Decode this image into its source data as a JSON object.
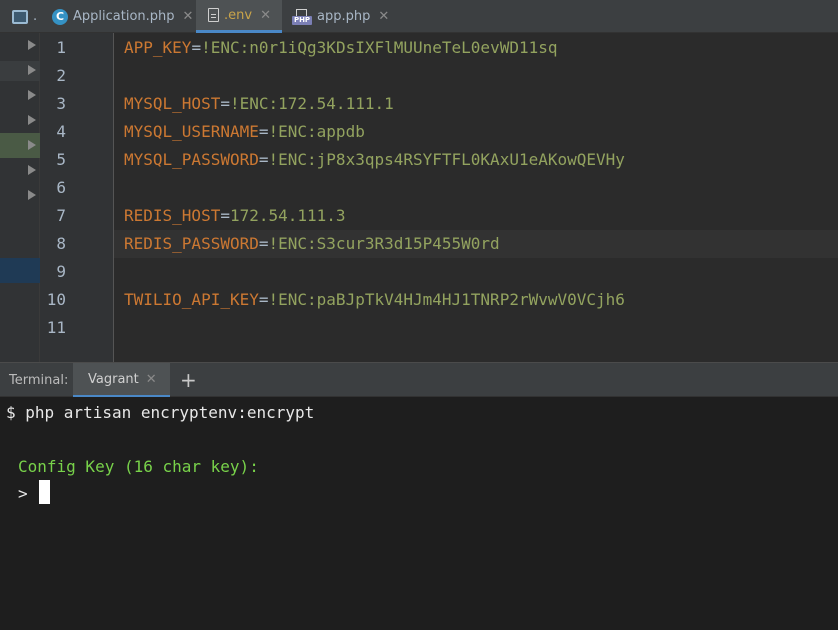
{
  "tabs": [
    {
      "label": ".",
      "icon": "project-icon"
    },
    {
      "label": "Application.php",
      "icon": "class-c-icon"
    },
    {
      "label": ".env",
      "icon": "text-file-icon",
      "active": true
    },
    {
      "label": "app.php",
      "icon": "php-file-icon"
    }
  ],
  "editor": {
    "line_numbers": [
      "1",
      "2",
      "3",
      "4",
      "5",
      "6",
      "7",
      "8",
      "9",
      "10",
      "11"
    ],
    "current_line": 8,
    "lines": [
      {
        "key": "APP_KEY",
        "eq": "=",
        "value": "!ENC:n0r1iQg3KDsIXFlMUUneTeL0evWD11sq"
      },
      {
        "key": "",
        "eq": "",
        "value": ""
      },
      {
        "key": "MYSQL_HOST",
        "eq": "=",
        "value": "!ENC:172.54.111.1"
      },
      {
        "key": "MYSQL_USERNAME",
        "eq": "=",
        "value": "!ENC:appdb"
      },
      {
        "key": "MYSQL_PASSWORD",
        "eq": "=",
        "value": "!ENC:jP8x3qps4RSYFTFL0KAxU1eAKowQEVHy"
      },
      {
        "key": "",
        "eq": "",
        "value": ""
      },
      {
        "key": "REDIS_HOST",
        "eq": "=",
        "value": "172.54.111.3"
      },
      {
        "key": "REDIS_PASSWORD",
        "eq": "=",
        "value": "!ENC:S3cur3R3d15P455W0rd"
      },
      {
        "key": "",
        "eq": "",
        "value": ""
      },
      {
        "key": "TWILIO_API_KEY",
        "eq": "=",
        "value": "!ENC:paBJpTkV4HJm4HJ1TNRP2rWvwV0VCjh6"
      },
      {
        "key": "",
        "eq": "",
        "value": ""
      }
    ]
  },
  "terminal": {
    "label": "Terminal:",
    "tab_label": "Vagrant",
    "close_glyph": "✕",
    "add_glyph": "+",
    "command": "$ php artisan encryptenv:encrypt",
    "config_prompt": "Config Key (16 char key):",
    "input_prompt": ">"
  },
  "colors": {
    "key": "#cc7832",
    "value": "#93a35f",
    "prompt_green": "#78d24a",
    "accent": "#4a88c7"
  }
}
